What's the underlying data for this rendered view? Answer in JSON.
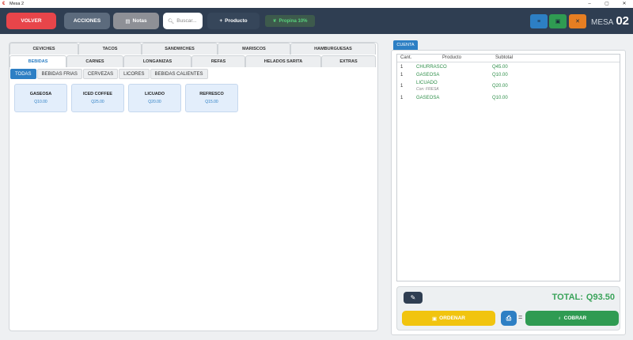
{
  "window": {
    "title": "Mesa 2",
    "minimize": "–",
    "maximize": "▢",
    "close": "✕"
  },
  "toolbar": {
    "volver": "VOLVER",
    "acciones": "ACCIONES",
    "notas": "Notas",
    "search_placeholder": "Buscar...",
    "producto": "Producto",
    "propina": "Propina 10%",
    "mesa_label": "MESA",
    "mesa_number": "02"
  },
  "categories_row1": [
    "CEVICHES",
    "TACOS",
    "SANDWICHES",
    "MARISCOS",
    "HAMBURGUESAS"
  ],
  "categories_row2": [
    "BEBIDAS",
    "CARNES",
    "LONGANIZAS",
    "REFAS",
    "HELADOS SARITA",
    "EXTRAS"
  ],
  "active_category": "BEBIDAS",
  "subcategories": [
    "TODAS",
    "BEBIDAS FRIAS",
    "CERVEZAS",
    "LICORES",
    "BEBIDAS CALIENTES"
  ],
  "products": [
    {
      "name": "GASEOSA",
      "price": "Q10.00"
    },
    {
      "name": "ICED COFFEE",
      "price": "Q25.00"
    },
    {
      "name": "LICUADO",
      "price": "Q20.00"
    },
    {
      "name": "REFRESCO",
      "price": "Q15.00"
    }
  ],
  "cuenta": {
    "tab": "CUENTA",
    "headers": {
      "qty": "Cant.",
      "product": "Producto",
      "subtotal": "Subtotal"
    },
    "rows": [
      {
        "qty": "1",
        "product": "CHURRASCO",
        "subtotal": "Q45.00"
      },
      {
        "qty": "1",
        "product": "GASEOSA",
        "subtotal": "Q10.00"
      },
      {
        "qty": "1",
        "product": "LICUADO",
        "modifier": "Con: FRESA",
        "subtotal": "Q20.00"
      },
      {
        "qty": "1",
        "product": "GASEOSA",
        "subtotal": "Q10.00"
      }
    ],
    "total_label": "TOTAL:",
    "total_value": "Q93.50",
    "ordenar": "ORDENAR",
    "cobrar": "COBRAR",
    "equals": "="
  },
  "colors": {
    "toolbar": "#2f3e52",
    "accent": "#2d7fc4",
    "danger": "#e8454a",
    "success": "#2f9b52",
    "warning": "#f1c40f"
  }
}
